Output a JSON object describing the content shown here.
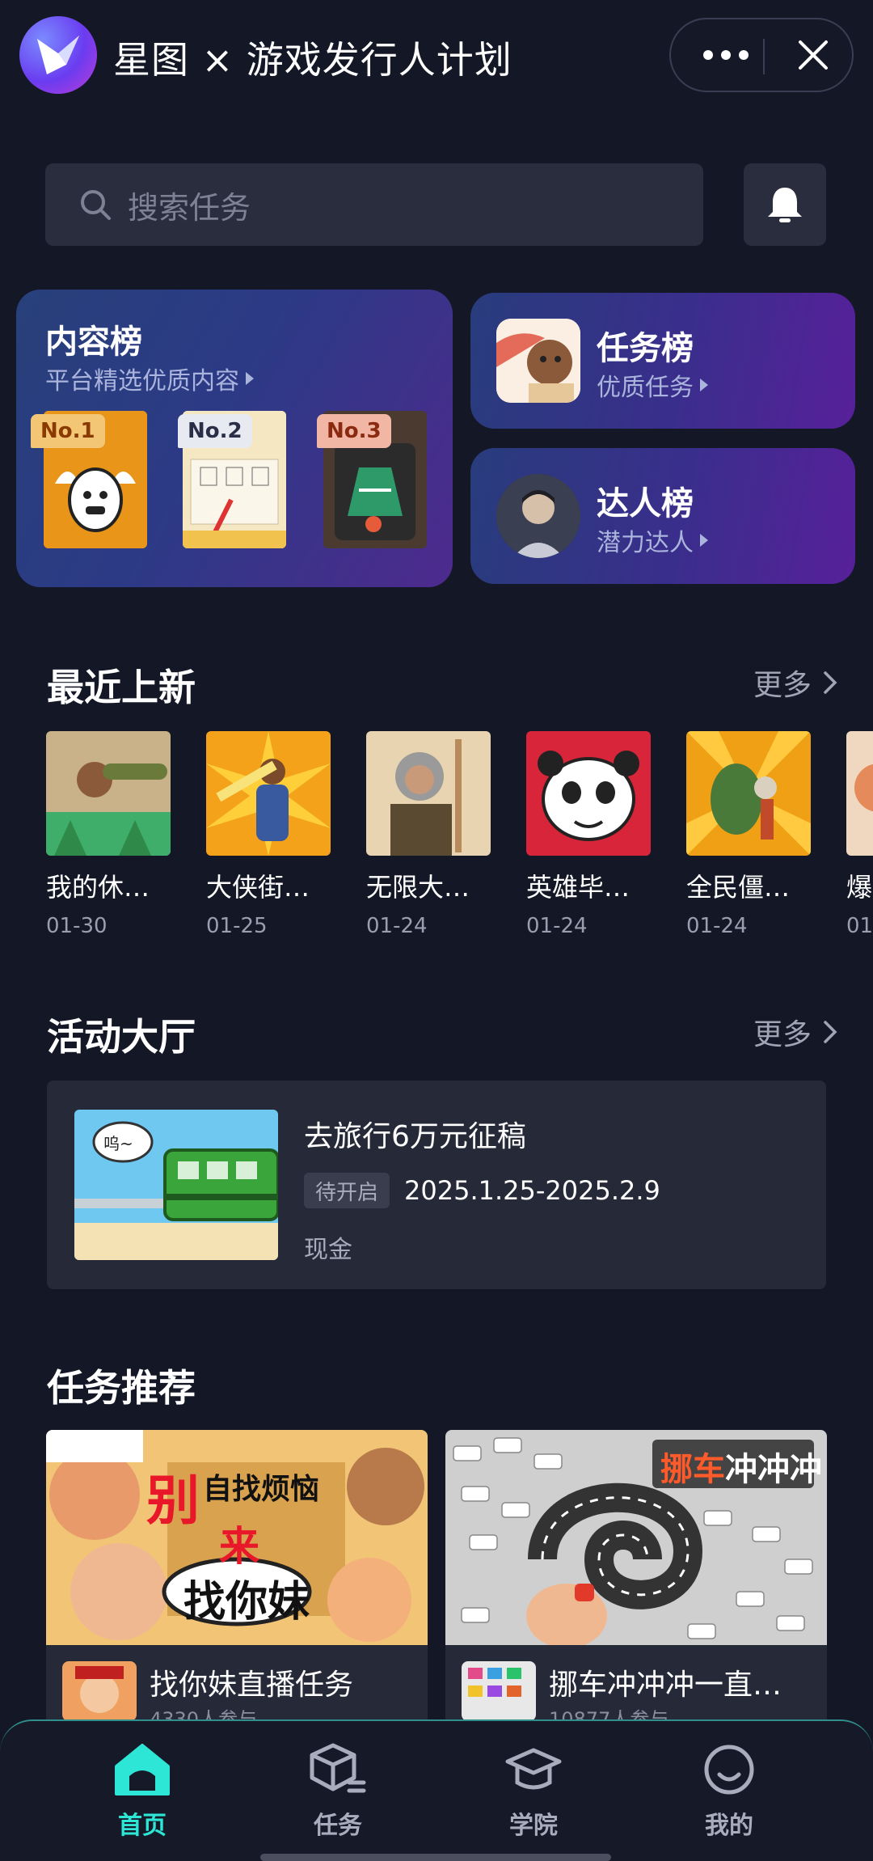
{
  "titlebar": {
    "title": "星图 × 游戏发行人计划",
    "logo_icon": "xingtu-logo-icon",
    "more_icon": "more-dots-icon",
    "close_icon": "close-icon"
  },
  "search": {
    "placeholder": "搜索任务",
    "icon": "search-icon",
    "bell_icon": "bell-icon"
  },
  "rankings": {
    "content": {
      "title": "内容榜",
      "subtitle": "平台精选优质内容",
      "items": [
        {
          "rank": "No.1"
        },
        {
          "rank": "No.2"
        },
        {
          "rank": "No.3"
        }
      ]
    },
    "task": {
      "title": "任务榜",
      "subtitle": "优质任务"
    },
    "talent": {
      "title": "达人榜",
      "subtitle": "潜力达人"
    }
  },
  "recent": {
    "title": "最近上新",
    "more": "更多",
    "games": [
      {
        "name": "我的休…",
        "date": "01-30"
      },
      {
        "name": "大侠街…",
        "date": "01-25"
      },
      {
        "name": "无限大…",
        "date": "01-24"
      },
      {
        "name": "英雄毕…",
        "date": "01-24"
      },
      {
        "name": "全民僵…",
        "date": "01-24"
      },
      {
        "name": "爆",
        "date": "01-"
      }
    ]
  },
  "activity": {
    "title": "活动大厅",
    "more": "更多",
    "item": {
      "title": "去旅行6万元征稿",
      "status": "待开启",
      "date_range": "2025.1.25-2025.2.9",
      "reward": "现金",
      "bubble": "呜~"
    }
  },
  "tasks": {
    "title": "任务推荐",
    "items": [
      {
        "title": "找你妹直播任务",
        "count": "4330人参与",
        "banner_text_1": "别",
        "banner_text_2": "自找烦恼",
        "banner_text_3": "来",
        "banner_text_4": "找你妹"
      },
      {
        "title": "挪车冲冲冲一直…",
        "count": "10877人参与",
        "banner_text_1": "挪车",
        "banner_text_2": "冲冲冲"
      }
    ]
  },
  "nav": {
    "items": [
      {
        "label": "首页",
        "icon": "home-icon",
        "active": true
      },
      {
        "label": "任务",
        "icon": "task-box-icon",
        "active": false
      },
      {
        "label": "学院",
        "icon": "graduation-cap-icon",
        "active": false
      },
      {
        "label": "我的",
        "icon": "smile-profile-icon",
        "active": false
      }
    ],
    "accent": "#2ee6d6"
  },
  "colors": {
    "background": "#141726",
    "card": "#262938",
    "accent": "#2ee6d6"
  }
}
